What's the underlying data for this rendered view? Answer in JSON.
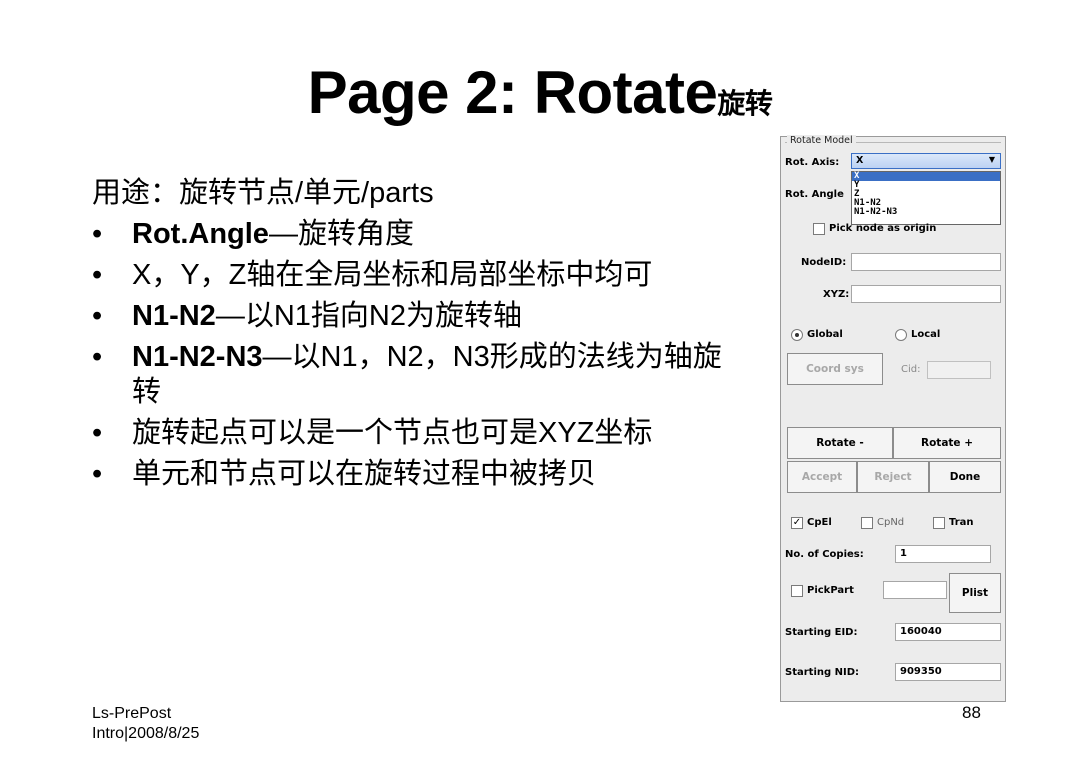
{
  "slide": {
    "title_main": "Page 2: Rotate",
    "title_suffix": "旋转",
    "intro": "用途：旋转节点/单元/parts",
    "bullets": [
      {
        "bold": "Rot.Angle",
        "rest": "—旋转角度"
      },
      {
        "bold": "",
        "rest": "X，Y，Z轴在全局坐标和局部坐标中均可"
      },
      {
        "bold": "N1-N2",
        "rest": "—以N1指向N2为旋转轴"
      },
      {
        "bold": "N1-N2-N3",
        "rest": "—以N1，N2，N3形成的法线为轴旋转"
      },
      {
        "bold": "",
        "rest": "旋转起点可以是一个节点也可是XYZ坐标"
      },
      {
        "bold": "",
        "rest": "单元和节点可以在旋转过程中被拷贝"
      }
    ],
    "bullet_glyph": "•",
    "footer_line1": "Ls-PrePost",
    "footer_line2": "Intro|2008/8/25",
    "page_number": "88"
  },
  "panel": {
    "group_title": "Rotate Model",
    "rot_axis_label": "Rot. Axis:",
    "rot_axis_value": "X",
    "axis_options": [
      "X",
      "Y",
      "Z",
      "N1-N2",
      "N1-N2-N3"
    ],
    "rot_angle_label": "Rot. Angle",
    "pick_node_label": "Pick node as origin",
    "nodeid_label": "NodeID:",
    "xyz_label": "XYZ:",
    "global_label": "Global",
    "local_label": "Local",
    "coord_sys_label": "Coord sys",
    "cid_label": "Cid:",
    "rotate_minus": "Rotate -",
    "rotate_plus": "Rotate +",
    "accept": "Accept",
    "reject": "Reject",
    "done": "Done",
    "cpel_label": "CpEl",
    "cpnd_label": "CpNd",
    "tran_label": "Tran",
    "copies_label": "No. of Copies:",
    "copies_value": "1",
    "pickpart_label": "PickPart",
    "plist_label": "Plist",
    "start_eid_label": "Starting EID:",
    "start_eid_value": "160040",
    "start_nid_label": "Starting NID:",
    "start_nid_value": "909350",
    "check_mark": "✓",
    "dropdown_arrow": "▼"
  }
}
